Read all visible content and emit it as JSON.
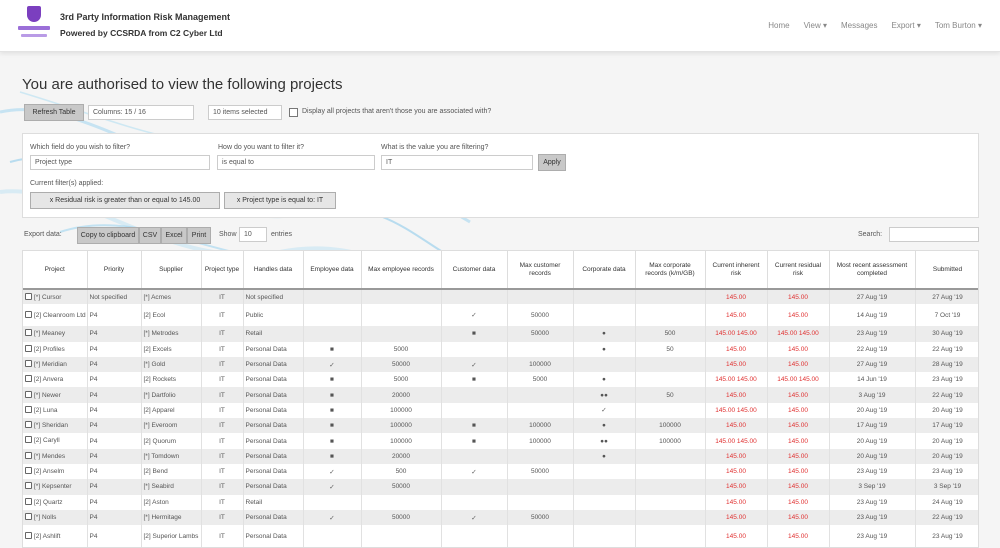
{
  "header": {
    "brand_line1": "3rd Party Information Risk Management",
    "brand_line2": "Powered by CCSRDA from C2 Cyber Ltd",
    "nav": [
      "Home",
      "View ▾",
      "Messages",
      "Export ▾",
      "Tom Burton ▾"
    ]
  },
  "page": {
    "title": "You are authorised to view the following projects",
    "refresh_label": "Refresh Table",
    "columns_label": "Columns: 15 / 16",
    "view_select": "10 items selected",
    "only_mine_label": "Display all projects that aren't those you are associated with?"
  },
  "filter": {
    "q1_label": "Which field do you wish to filter?",
    "q1_value": "Project type",
    "q2_label": "How do you want to filter it?",
    "q2_value": "is equal to",
    "q3_label": "What is the value you are filtering?",
    "q3_value": "IT",
    "apply_label": "Apply",
    "current_label": "Current filter(s) applied:",
    "chip1": "x Residual risk is greater than or equal to 145.00",
    "chip2": "x Project type is equal to: IT"
  },
  "toolbar": {
    "export_label": "Export data:",
    "copy_label": "Copy to clipboard",
    "csv_label": "CSV",
    "excel_label": "Excel",
    "print_label": "Print",
    "show_label": "Show",
    "show_value": "10",
    "entries_label": "entries",
    "search_label": "Search:"
  },
  "table": {
    "columns": [
      "Project",
      "Priority",
      "Supplier",
      "Project type",
      "Handles data",
      "Employee data",
      "Max employee records",
      "Customer data",
      "Max customer records",
      "Corporate data",
      "Max corporate records (k/m/GB)",
      "Current inherent risk",
      "Current residual risk",
      "Most recent assessment completed",
      "Submitted"
    ],
    "rows": [
      [
        "[*] Cursor",
        "Not specified",
        "[*] Acmes",
        "IT",
        "Not specified",
        "",
        "",
        "",
        "",
        "",
        "",
        "145.00",
        "145.00",
        "27 Aug '19",
        "27 Aug '19"
      ],
      [
        "[2] Cleanroom Ltd",
        "P4",
        "[2] Ecol",
        "IT",
        "Public",
        "",
        "",
        "✓",
        "50000",
        "",
        "",
        "145.00",
        "145.00",
        "14 Aug '19",
        "7 Oct '19"
      ],
      [
        "[*] Meaney",
        "P4",
        "[*] Metrodes",
        "IT",
        "Retail",
        "",
        "",
        "■",
        "50000",
        "●",
        "500",
        "145.00 145.00",
        "145.00 145.00",
        "23 Aug '19",
        "30 Aug '19"
      ],
      [
        "[2] Profiles",
        "P4",
        "[2] Excels",
        "IT",
        "Personal Data",
        "■",
        "5000",
        "",
        "",
        "●",
        "50",
        "145.00",
        "145.00",
        "22 Aug '19",
        "22 Aug '19"
      ],
      [
        "[*] Meridian",
        "P4",
        "[*] Gold",
        "IT",
        "Personal Data",
        "✓",
        "50000",
        "✓",
        "100000",
        "",
        "",
        "145.00",
        "145.00",
        "27 Aug '19",
        "28 Aug '19"
      ],
      [
        "[2] Anvera",
        "P4",
        "[2] Rockets",
        "IT",
        "Personal Data",
        "■",
        "5000",
        "■",
        "5000",
        "●",
        "",
        "145.00 145.00",
        "145.00 145.00",
        "14 Jun '19",
        "23 Aug '19"
      ],
      [
        "[*] Newer",
        "P4",
        "[*] Dartfolio",
        "IT",
        "Personal Data",
        "■",
        "20000",
        "",
        "",
        "●●",
        "50",
        "145.00",
        "145.00",
        "3 Aug '19",
        "22 Aug '19"
      ],
      [
        "[2] Luna",
        "P4",
        "[2] Apparel",
        "IT",
        "Personal Data",
        "■",
        "100000",
        "",
        "",
        "✓",
        "",
        "145.00 145.00",
        "145.00",
        "20 Aug '19",
        "20 Aug '19"
      ],
      [
        "[*] Sheridan",
        "P4",
        "[*] Everoom",
        "IT",
        "Personal Data",
        "■",
        "100000",
        "■",
        "100000",
        "●",
        "100000",
        "145.00",
        "145.00",
        "17 Aug '19",
        "17 Aug '19"
      ],
      [
        "[2] Caryll",
        "P4",
        "[2] Quorum",
        "IT",
        "Personal Data",
        "■",
        "100000",
        "■",
        "100000",
        "●●",
        "100000",
        "145.00 145.00",
        "145.00",
        "20 Aug '19",
        "20 Aug '19"
      ],
      [
        "[*] Mendes",
        "P4",
        "[*] Tomdown",
        "IT",
        "Personal Data",
        "■",
        "20000",
        "",
        "",
        "●",
        "",
        "145.00",
        "145.00",
        "20 Aug '19",
        "20 Aug '19"
      ],
      [
        "[2] Anselm",
        "P4",
        "[2] Bend",
        "IT",
        "Personal Data",
        "✓",
        "500",
        "✓",
        "50000",
        "",
        "",
        "145.00",
        "145.00",
        "23 Aug '19",
        "23 Aug '19"
      ],
      [
        "[*] Kepsenter",
        "P4",
        "[*] Seabird",
        "IT",
        "Personal Data",
        "✓",
        "50000",
        "",
        "",
        "",
        "",
        "145.00",
        "145.00",
        "3 Sep '19",
        "3 Sep '19"
      ],
      [
        "[2] Quartz",
        "P4",
        "[2] Aston",
        "IT",
        "Retail",
        "",
        "",
        "",
        "",
        "",
        "",
        "145.00",
        "145.00",
        "23 Aug '19",
        "24 Aug '19"
      ],
      [
        "[*] Nolls",
        "P4",
        "[*] Hermitage",
        "IT",
        "Personal Data",
        "✓",
        "50000",
        "✓",
        "50000",
        "",
        "",
        "145.00",
        "145.00",
        "23 Aug '19",
        "22 Aug '19"
      ],
      [
        "[2] Ashlift",
        "P4",
        "[2] Superior Lambs",
        "IT",
        "Personal Data",
        "",
        "",
        "",
        "",
        "",
        "",
        "145.00",
        "145.00",
        "23 Aug '19",
        "23 Aug '19"
      ]
    ]
  }
}
